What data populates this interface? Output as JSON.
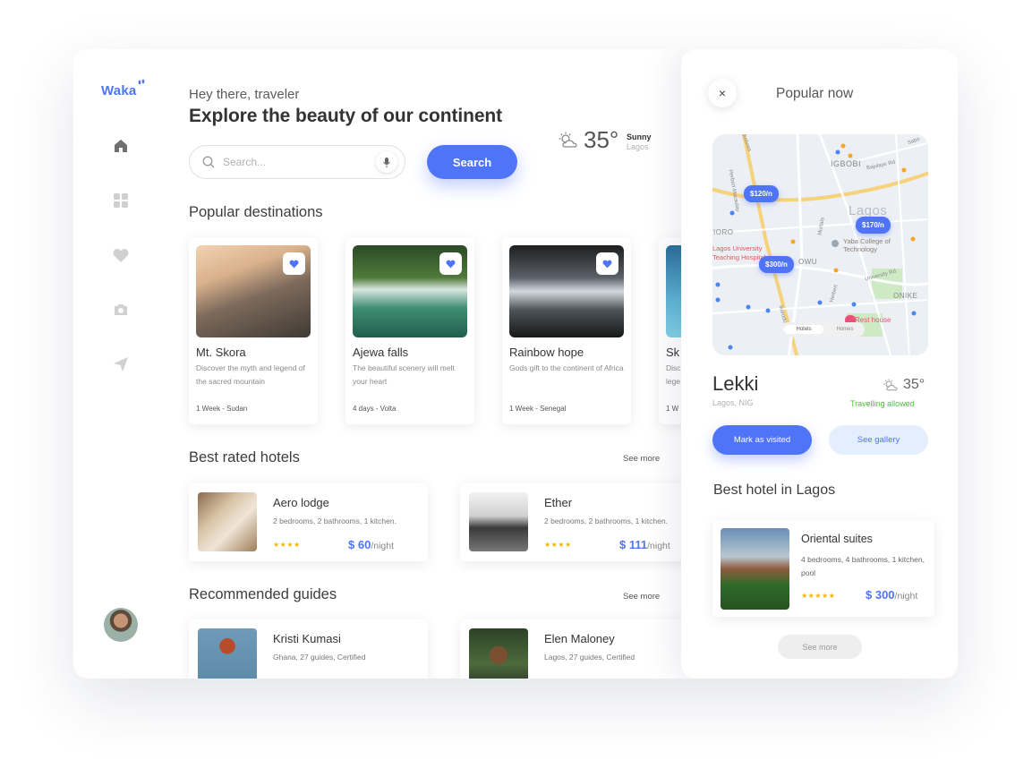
{
  "brand": {
    "logo": "Waka"
  },
  "header": {
    "greeting": "Hey there, traveler",
    "headline": "Explore the beauty of our continent"
  },
  "search": {
    "placeholder": "Search...",
    "button_label": "Search"
  },
  "weather": {
    "temp": "35°",
    "condition": "Sunny",
    "city": "Lagos"
  },
  "sidebar": {
    "icons": [
      "home-icon",
      "grid-icon",
      "heart-icon",
      "camera-icon",
      "send-icon"
    ]
  },
  "destinations": {
    "title": "Popular destinations",
    "items": [
      {
        "name": "Mt. Skora",
        "description": "Discover the myth and legend of the sacred mountain",
        "meta": "1 Week - Sudan"
      },
      {
        "name": "Ajewa falls",
        "description": "The beautiful scenery will melt your heart",
        "meta": "4 days - Volta"
      },
      {
        "name": "Rainbow hope",
        "description": "Gods gift to the continent of Africa",
        "meta": "1 Week - Senegal"
      },
      {
        "name": "Sk",
        "description": "Disc lege",
        "meta": "1 W"
      }
    ]
  },
  "hotels": {
    "title": "Best rated hotels",
    "see_more": "See more",
    "items": [
      {
        "name": "Aero lodge",
        "description": "2 bedrooms, 2 bathrooms, 1 kitchen.",
        "stars": "★★★★",
        "price": "$ 60",
        "per": "/night"
      },
      {
        "name": "Ether",
        "description": "2 bedrooms, 2 bathrooms, 1 kitchen.",
        "stars": "★★★★",
        "price": "$ 111",
        "per": "/night"
      }
    ]
  },
  "guides": {
    "title": "Recommended guides",
    "see_more": "See more",
    "items": [
      {
        "name": "Kristi Kumasi",
        "description": "Ghana, 27 guides, Certified"
      },
      {
        "name": "Elen Maloney",
        "description": "Lagos, 27 guides, Certified"
      }
    ]
  },
  "panel": {
    "close": "×",
    "title": "Popular now",
    "map": {
      "pins": [
        "$120/n",
        "$170/n",
        "$300/n"
      ],
      "labels": [
        "IGBOBI",
        "Lagos",
        "Yaba College of Technology",
        "IORO",
        "Lagos University Teaching Hospital",
        "OWU",
        "ONIKE",
        "University Rd",
        "Bajulaye Rd",
        "Oduduwa",
        "Ikorodu",
        "Sabo",
        "Herbert Macaulay",
        "Murtala",
        "Herbert",
        "Rest house"
      ],
      "toggle": [
        "Hotels",
        "Homes"
      ]
    },
    "place": {
      "name": "Lekki",
      "subtitle": "Lagos, NIG",
      "temp": "35°",
      "status": "Travelling allowed"
    },
    "buttons": {
      "visited": "Mark as visited",
      "gallery": "See gallery"
    },
    "best_hotel": {
      "title": "Best hotel in Lagos",
      "name": "Oriental suites",
      "description": "4 bedrooms, 4 bathrooms, 1 kitchen, pool",
      "stars": "★★★★★",
      "price": "$ 300",
      "per": "/night"
    },
    "see_more": "See more"
  },
  "colors": {
    "accent": "#4f74f7",
    "accent_light": "#e4eefc",
    "success": "#4fbf3a",
    "star": "#f7b500"
  }
}
